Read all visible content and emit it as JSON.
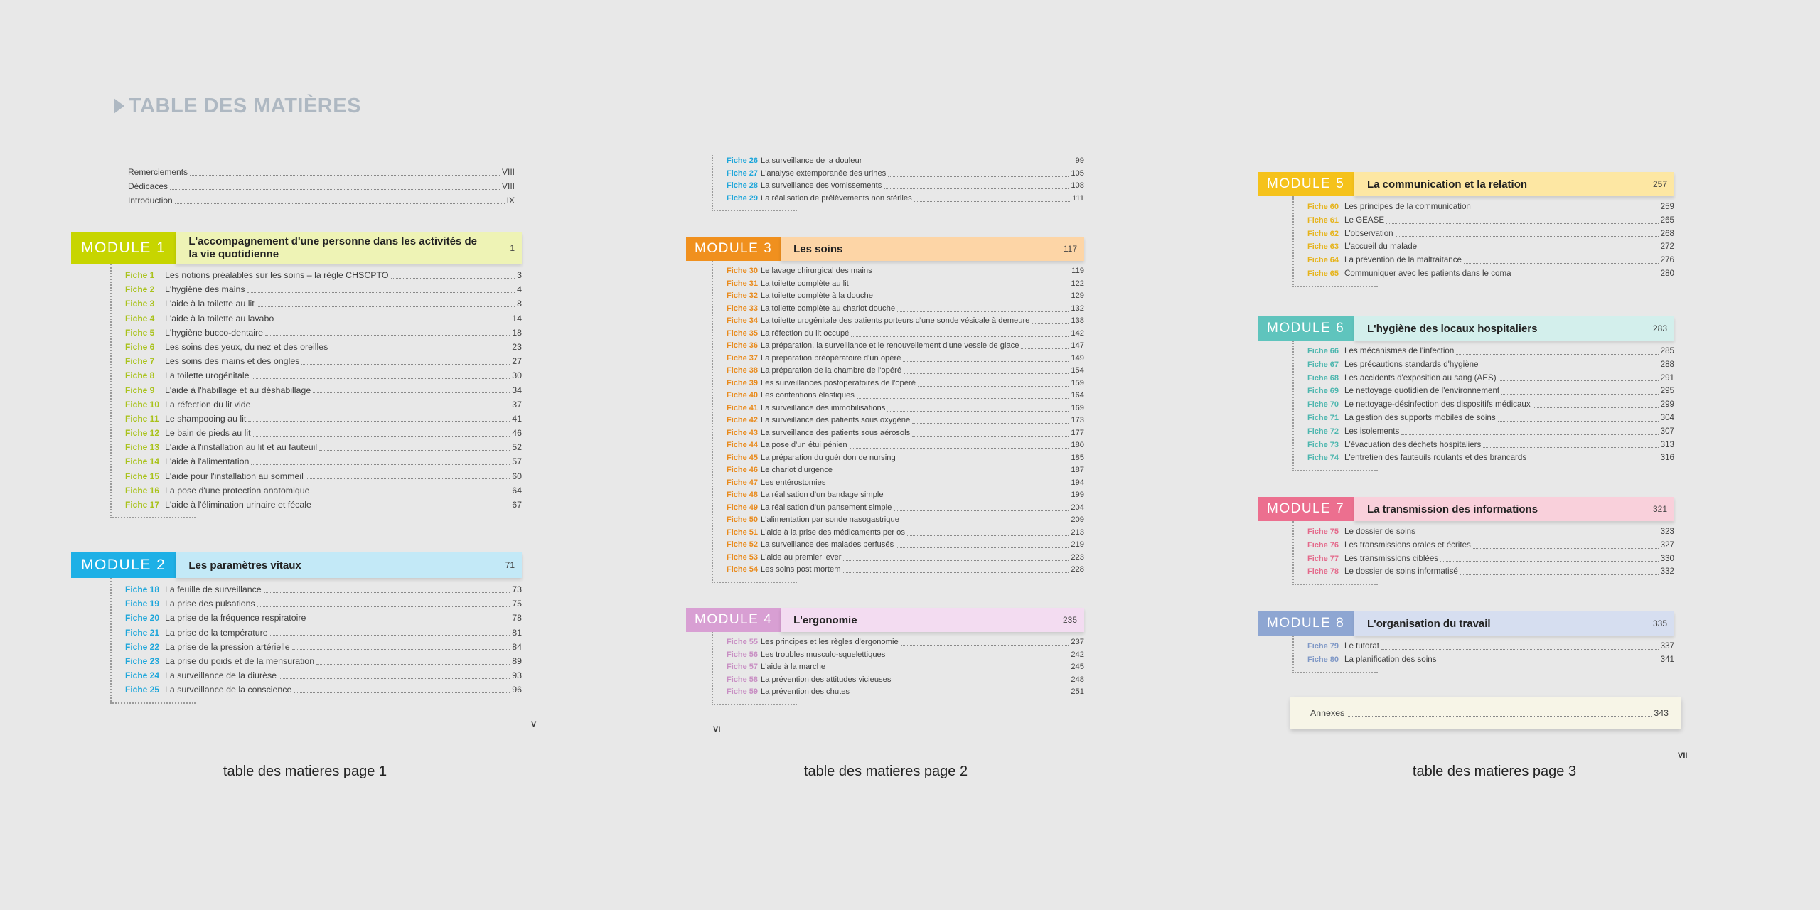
{
  "title": "TABLE DES MATIÈRES",
  "colors": {
    "m1_badge": "#c7d500",
    "m1_band": "#eef3b5",
    "m1_fiche": "#a9c21b",
    "m2_badge": "#1eb0e6",
    "m2_band": "#c3e9f7",
    "m2_fiche": "#1ea6da",
    "m3_badge": "#f0901e",
    "m3_band": "#fdd5a6",
    "m3_fiche": "#e98a1b",
    "m4_badge": "#d89fd3",
    "m4_band": "#f3dcf1",
    "m4_fiche": "#c88ec3",
    "m5_badge": "#f5c21b",
    "m5_band": "#fde7a3",
    "m5_fiche": "#e6b31a",
    "m6_badge": "#5fc4bd",
    "m6_band": "#d3efec",
    "m6_fiche": "#4cb6ae",
    "m7_badge": "#ec6f8f",
    "m7_band": "#f9d0db",
    "m7_fiche": "#e4688a",
    "m8_badge": "#8ea6d2",
    "m8_band": "#d6def0",
    "m8_fiche": "#7e97c6"
  },
  "intro": [
    {
      "t": "Remerciements",
      "p": "VIII"
    },
    {
      "t": "Dédicaces",
      "p": "VIII"
    },
    {
      "t": "Introduction",
      "p": "IX"
    }
  ],
  "m1": {
    "badge": "MODULE 1",
    "title": "L'accompagnement d'une personne dans les activités de la vie quotidienne",
    "page": "1",
    "fiches": [
      {
        "f": "Fiche 1",
        "t": "Les notions préalables sur les soins – la règle CHSCPTO",
        "p": "3"
      },
      {
        "f": "Fiche 2",
        "t": "L'hygiène des mains",
        "p": "4"
      },
      {
        "f": "Fiche 3",
        "t": "L'aide à la toilette au lit",
        "p": "8"
      },
      {
        "f": "Fiche 4",
        "t": "L'aide à la toilette au lavabo",
        "p": "14"
      },
      {
        "f": "Fiche 5",
        "t": "L'hygiène bucco-dentaire",
        "p": "18"
      },
      {
        "f": "Fiche 6",
        "t": "Les soins des yeux, du nez et des oreilles",
        "p": "23"
      },
      {
        "f": "Fiche 7",
        "t": "Les soins des mains et des ongles",
        "p": "27"
      },
      {
        "f": "Fiche 8",
        "t": "La toilette urogénitale",
        "p": "30"
      },
      {
        "f": "Fiche 9",
        "t": "L'aide à l'habillage et au déshabillage",
        "p": "34"
      },
      {
        "f": "Fiche 10",
        "t": "La réfection du lit vide",
        "p": "37"
      },
      {
        "f": "Fiche 11",
        "t": "Le shampooing au lit",
        "p": "41"
      },
      {
        "f": "Fiche 12",
        "t": "Le bain de pieds au lit",
        "p": "46"
      },
      {
        "f": "Fiche 13",
        "t": "L'aide à l'installation au lit et au fauteuil",
        "p": "52"
      },
      {
        "f": "Fiche 14",
        "t": "L'aide à l'alimentation",
        "p": "57"
      },
      {
        "f": "Fiche 15",
        "t": "L'aide pour l'installation au sommeil",
        "p": "60"
      },
      {
        "f": "Fiche 16",
        "t": "La pose d'une protection anatomique",
        "p": "64"
      },
      {
        "f": "Fiche 17",
        "t": "L'aide à l'élimination urinaire et fécale",
        "p": "67"
      }
    ]
  },
  "m2": {
    "badge": "MODULE 2",
    "title": "Les paramètres vitaux",
    "page": "71",
    "fiches": [
      {
        "f": "Fiche 18",
        "t": "La feuille de surveillance",
        "p": "73"
      },
      {
        "f": "Fiche 19",
        "t": "La prise des pulsations",
        "p": "75"
      },
      {
        "f": "Fiche 20",
        "t": "La prise de la fréquence respiratoire",
        "p": "78"
      },
      {
        "f": "Fiche 21",
        "t": "La prise de la température",
        "p": "81"
      },
      {
        "f": "Fiche 22",
        "t": "La prise de la pression artérielle",
        "p": "84"
      },
      {
        "f": "Fiche 23",
        "t": "La prise du poids et de la mensuration",
        "p": "89"
      },
      {
        "f": "Fiche 24",
        "t": "La surveillance de la diurèse",
        "p": "93"
      },
      {
        "f": "Fiche 25",
        "t": "La surveillance de la conscience",
        "p": "96"
      }
    ]
  },
  "m2b": {
    "fiches": [
      {
        "f": "Fiche 26",
        "t": "La surveillance de la douleur",
        "p": "99"
      },
      {
        "f": "Fiche 27",
        "t": "L'analyse extemporanée des urines",
        "p": "105"
      },
      {
        "f": "Fiche 28",
        "t": "La surveillance des vomissements",
        "p": "108"
      },
      {
        "f": "Fiche 29",
        "t": "La réalisation de prélèvements non stériles",
        "p": "111"
      }
    ]
  },
  "m3": {
    "badge": "MODULE 3",
    "title": "Les soins",
    "page": "117",
    "fiches": [
      {
        "f": "Fiche 30",
        "t": "Le lavage chirurgical des mains",
        "p": "119"
      },
      {
        "f": "Fiche 31",
        "t": "La toilette complète au lit",
        "p": "122"
      },
      {
        "f": "Fiche 32",
        "t": "La toilette complète à la douche",
        "p": "129"
      },
      {
        "f": "Fiche 33",
        "t": "La toilette complète au chariot douche",
        "p": "132"
      },
      {
        "f": "Fiche 34",
        "t": "La toilette urogénitale des patients porteurs d'une sonde vésicale à demeure",
        "p": "138"
      },
      {
        "f": "Fiche 35",
        "t": "La réfection du lit occupé",
        "p": "142"
      },
      {
        "f": "Fiche 36",
        "t": "La préparation, la surveillance et le renouvellement d'une vessie de glace",
        "p": "147"
      },
      {
        "f": "Fiche 37",
        "t": "La préparation préopératoire d'un opéré",
        "p": "149"
      },
      {
        "f": "Fiche 38",
        "t": "La préparation de la chambre de l'opéré",
        "p": "154"
      },
      {
        "f": "Fiche 39",
        "t": "Les surveillances postopératoires de l'opéré",
        "p": "159"
      },
      {
        "f": "Fiche 40",
        "t": "Les contentions élastiques",
        "p": "164"
      },
      {
        "f": "Fiche 41",
        "t": "La surveillance des immobilisations",
        "p": "169"
      },
      {
        "f": "Fiche 42",
        "t": "La surveillance des patients sous oxygène",
        "p": "173"
      },
      {
        "f": "Fiche 43",
        "t": "La surveillance des patients sous aérosols",
        "p": "177"
      },
      {
        "f": "Fiche 44",
        "t": "La pose d'un étui pénien",
        "p": "180"
      },
      {
        "f": "Fiche 45",
        "t": "La préparation du guéridon de nursing",
        "p": "185"
      },
      {
        "f": "Fiche 46",
        "t": "Le chariot d'urgence",
        "p": "187"
      },
      {
        "f": "Fiche 47",
        "t": "Les entérostomies",
        "p": "194"
      },
      {
        "f": "Fiche 48",
        "t": "La réalisation d'un bandage simple",
        "p": "199"
      },
      {
        "f": "Fiche 49",
        "t": "La réalisation d'un pansement simple",
        "p": "204"
      },
      {
        "f": "Fiche 50",
        "t": "L'alimentation par sonde nasogastrique",
        "p": "209"
      },
      {
        "f": "Fiche 51",
        "t": "L'aide à la prise des médicaments per os",
        "p": "213"
      },
      {
        "f": "Fiche 52",
        "t": "La surveillance des malades perfusés",
        "p": "219"
      },
      {
        "f": "Fiche 53",
        "t": "L'aide au premier lever",
        "p": "223"
      },
      {
        "f": "Fiche 54",
        "t": "Les soins post mortem",
        "p": "228"
      }
    ]
  },
  "m4": {
    "badge": "MODULE 4",
    "title": "L'ergonomie",
    "page": "235",
    "fiches": [
      {
        "f": "Fiche 55",
        "t": "Les principes et les règles d'ergonomie",
        "p": "237"
      },
      {
        "f": "Fiche 56",
        "t": "Les troubles musculo-squelettiques",
        "p": "242"
      },
      {
        "f": "Fiche 57",
        "t": "L'aide à la marche",
        "p": "245"
      },
      {
        "f": "Fiche 58",
        "t": "La prévention des attitudes vicieuses",
        "p": "248"
      },
      {
        "f": "Fiche 59",
        "t": "La prévention des chutes",
        "p": "251"
      }
    ]
  },
  "m5": {
    "badge": "MODULE 5",
    "title": "La communication et la relation",
    "page": "257",
    "fiches": [
      {
        "f": "Fiche 60",
        "t": "Les principes de la communication",
        "p": "259"
      },
      {
        "f": "Fiche 61",
        "t": "Le GEASE",
        "p": "265"
      },
      {
        "f": "Fiche 62",
        "t": "L'observation",
        "p": "268"
      },
      {
        "f": "Fiche 63",
        "t": "L'accueil du malade",
        "p": "272"
      },
      {
        "f": "Fiche 64",
        "t": "La prévention de la maltraitance",
        "p": "276"
      },
      {
        "f": "Fiche 65",
        "t": "Communiquer avec les patients dans le coma",
        "p": "280"
      }
    ]
  },
  "m6": {
    "badge": "MODULE 6",
    "title": "L'hygiène des locaux hospitaliers",
    "page": "283",
    "fiches": [
      {
        "f": "Fiche 66",
        "t": "Les mécanismes de l'infection",
        "p": "285"
      },
      {
        "f": "Fiche 67",
        "t": "Les précautions standards d'hygiène",
        "p": "288"
      },
      {
        "f": "Fiche 68",
        "t": "Les accidents d'exposition au sang (AES)",
        "p": "291"
      },
      {
        "f": "Fiche 69",
        "t": "Le nettoyage quotidien de l'environnement",
        "p": "295"
      },
      {
        "f": "Fiche 70",
        "t": "Le nettoyage-désinfection des dispositifs médicaux",
        "p": "299"
      },
      {
        "f": "Fiche 71",
        "t": "La gestion des supports mobiles de soins",
        "p": "304"
      },
      {
        "f": "Fiche 72",
        "t": "Les isolements",
        "p": "307"
      },
      {
        "f": "Fiche 73",
        "t": "L'évacuation des déchets hospitaliers",
        "p": "313"
      },
      {
        "f": "Fiche 74",
        "t": "L'entretien des fauteuils roulants et des brancards",
        "p": "316"
      }
    ]
  },
  "m7": {
    "badge": "MODULE 7",
    "title": "La transmission des informations",
    "page": "321",
    "fiches": [
      {
        "f": "Fiche 75",
        "t": "Le dossier de soins",
        "p": "323"
      },
      {
        "f": "Fiche 76",
        "t": "Les transmissions orales et écrites",
        "p": "327"
      },
      {
        "f": "Fiche 77",
        "t": "Les transmissions ciblées",
        "p": "330"
      },
      {
        "f": "Fiche 78",
        "t": "Le dossier de soins informatisé",
        "p": "332"
      }
    ]
  },
  "m8": {
    "badge": "MODULE 8",
    "title": "L'organisation du travail",
    "page": "335",
    "fiches": [
      {
        "f": "Fiche 79",
        "t": "Le tutorat",
        "p": "337"
      },
      {
        "f": "Fiche 80",
        "t": "La planification des soins",
        "p": "341"
      }
    ]
  },
  "annexes": {
    "t": "Annexes",
    "p": "343"
  },
  "page_numbers": {
    "p1": "V",
    "p2": "VI",
    "p3": "VII"
  },
  "captions": {
    "c1": "table des matieres page 1",
    "c2": "table des matieres page 2",
    "c3": "table des matieres page 3"
  }
}
